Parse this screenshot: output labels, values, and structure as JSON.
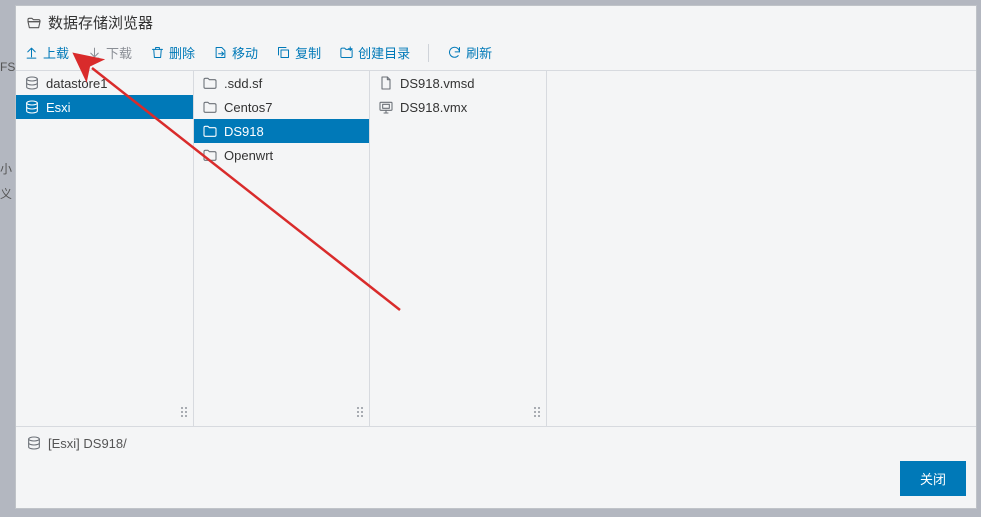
{
  "bg": {
    "left_frag_1": "FS",
    "left_frag_2": "小",
    "left_frag_3": "义"
  },
  "dialog": {
    "title": "数据存储浏览器",
    "toolbar": {
      "upload": "上载",
      "download": "下载",
      "delete": "删除",
      "move": "移动",
      "copy": "复制",
      "mkdir": "创建目录",
      "refresh": "刷新"
    },
    "columns": {
      "c0": [
        {
          "icon": "datastore",
          "label": "datastore1",
          "selected": false
        },
        {
          "icon": "datastore",
          "label": "Esxi",
          "selected": true
        }
      ],
      "c1": [
        {
          "icon": "folder",
          "label": ".sdd.sf",
          "selected": false
        },
        {
          "icon": "folder",
          "label": "Centos7",
          "selected": false
        },
        {
          "icon": "folder",
          "label": "DS918",
          "selected": true
        },
        {
          "icon": "folder",
          "label": "Openwrt",
          "selected": false
        }
      ],
      "c2": [
        {
          "icon": "file",
          "label": "DS918.vmsd",
          "selected": false
        },
        {
          "icon": "vm",
          "label": "DS918.vmx",
          "selected": false
        }
      ]
    },
    "status": {
      "path": "[Esxi] DS918/"
    },
    "footer": {
      "close": "关闭"
    }
  }
}
